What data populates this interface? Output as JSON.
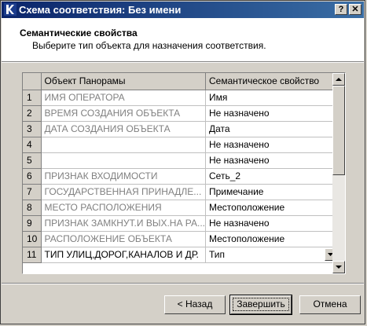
{
  "window": {
    "title": "Схема соответствия: Без имени",
    "help_label": "?",
    "close_label": "✕"
  },
  "header": {
    "title": "Семантические свойства",
    "subtitle": "Выберите тип объекта для назначения соответствия."
  },
  "grid": {
    "columns": [
      "Объект Панорамы",
      "Семантическое свойство"
    ],
    "rows": [
      {
        "num": "1",
        "object": "ИМЯ ОПЕРАТОРА",
        "property": "Имя"
      },
      {
        "num": "2",
        "object": "ВРЕМЯ СОЗДАНИЯ ОБЪЕКТА",
        "property": "Не назначено"
      },
      {
        "num": "3",
        "object": "ДАТА СОЗДАНИЯ ОБЪЕКТА",
        "property": "Дата"
      },
      {
        "num": "4",
        "object": "",
        "property": "Не назначено"
      },
      {
        "num": "5",
        "object": "",
        "property": "Не назначено"
      },
      {
        "num": "6",
        "object": "ПРИЗНАК ВХОДИМОСТИ",
        "property": "Сеть_2"
      },
      {
        "num": "7",
        "object": "ГОСУДАРСТВЕННАЯ ПРИНАДЛЕ...",
        "property": "Примечание"
      },
      {
        "num": "8",
        "object": "МЕСТО РАСПОЛОЖЕНИЯ",
        "property": "Местоположение"
      },
      {
        "num": "9",
        "object": "ПРИЗНАК ЗАМКНУТ.И ВЫХ.НА РА...",
        "property": "Не назначено"
      },
      {
        "num": "10",
        "object": "РАСПОЛОЖЕНИЕ ОБЪЕКТА",
        "property": "Местоположение"
      },
      {
        "num": "11",
        "object": "ТИП УЛИЦ,ДОРОГ,КАНАЛОВ И ДР.",
        "property": "Тип"
      }
    ]
  },
  "buttons": {
    "back": "< Назад",
    "finish": "Завершить",
    "cancel": "Отмена"
  }
}
